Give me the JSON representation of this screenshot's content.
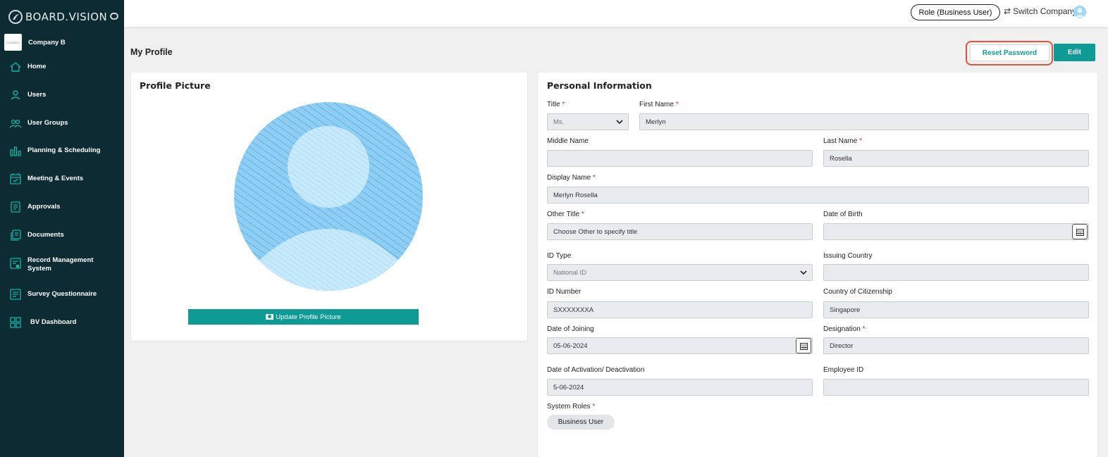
{
  "app": {
    "brand": "BOARD.VISION",
    "company_name": "Company B",
    "company_logo_text": "COMPANY",
    "accent_color": "#0e9b96",
    "sidebar_color": "#0d2b33",
    "highlight_color": "#e0533e"
  },
  "sidebar": {
    "items": [
      {
        "label": "Home",
        "icon": "home-icon"
      },
      {
        "label": "Users",
        "icon": "user-icon"
      },
      {
        "label": "User Groups",
        "icon": "users-icon"
      },
      {
        "label": "Planning & Scheduling",
        "icon": "bar-chart-icon"
      },
      {
        "label": "Meeting & Events",
        "icon": "calendar-check-icon"
      },
      {
        "label": "Approvals",
        "icon": "document-list-icon"
      },
      {
        "label": "Documents",
        "icon": "documents-icon"
      },
      {
        "label": "Record Management System",
        "icon": "record-icon"
      },
      {
        "label": "Survey Questionnaire",
        "icon": "survey-icon"
      },
      {
        "label": "BV Dashboard",
        "icon": "dashboard-grid-icon"
      }
    ]
  },
  "header": {
    "role_button": "Role (Business User)",
    "switch_company": "Switch Company"
  },
  "page": {
    "title": "My Profile",
    "reset_password": "Reset Password",
    "edit": "Edit"
  },
  "profile_picture": {
    "title": "Profile Picture",
    "update_button": "Update Profile Picture"
  },
  "personal_info": {
    "title": "Personal Information",
    "required_mark": "*",
    "fields": {
      "title": {
        "label": "Title",
        "value": "Ms."
      },
      "first_name": {
        "label": "First Name",
        "value": "Merlyn"
      },
      "middle_name": {
        "label": "Middle Name",
        "value": ""
      },
      "last_name": {
        "label": "Last Name",
        "value": "Rosella"
      },
      "display_name": {
        "label": "Display Name",
        "value": "Merlyn Rosella"
      },
      "other_title": {
        "label": "Other Title",
        "placeholder": "Choose Other to specify title"
      },
      "date_of_birth": {
        "label": "Date of Birth",
        "value": ""
      },
      "id_type": {
        "label": "ID Type",
        "value": "National ID"
      },
      "issuing_country": {
        "label": "Issuing Country",
        "value": ""
      },
      "id_number": {
        "label": "ID Number",
        "value": "SXXXXXXXA"
      },
      "citizenship": {
        "label": "Country of Citizenship",
        "value": "Singapore"
      },
      "date_of_joining": {
        "label": "Date of Joining",
        "value": "05-06-2024"
      },
      "designation": {
        "label": "Designation",
        "value": "Director"
      },
      "activation": {
        "label": "Date of Activation/ Deactivation",
        "value": "5-06-2024"
      },
      "employee_id": {
        "label": "Employee ID",
        "value": ""
      },
      "system_roles": {
        "label": "System Roles",
        "chips": [
          "Business User"
        ]
      }
    }
  }
}
